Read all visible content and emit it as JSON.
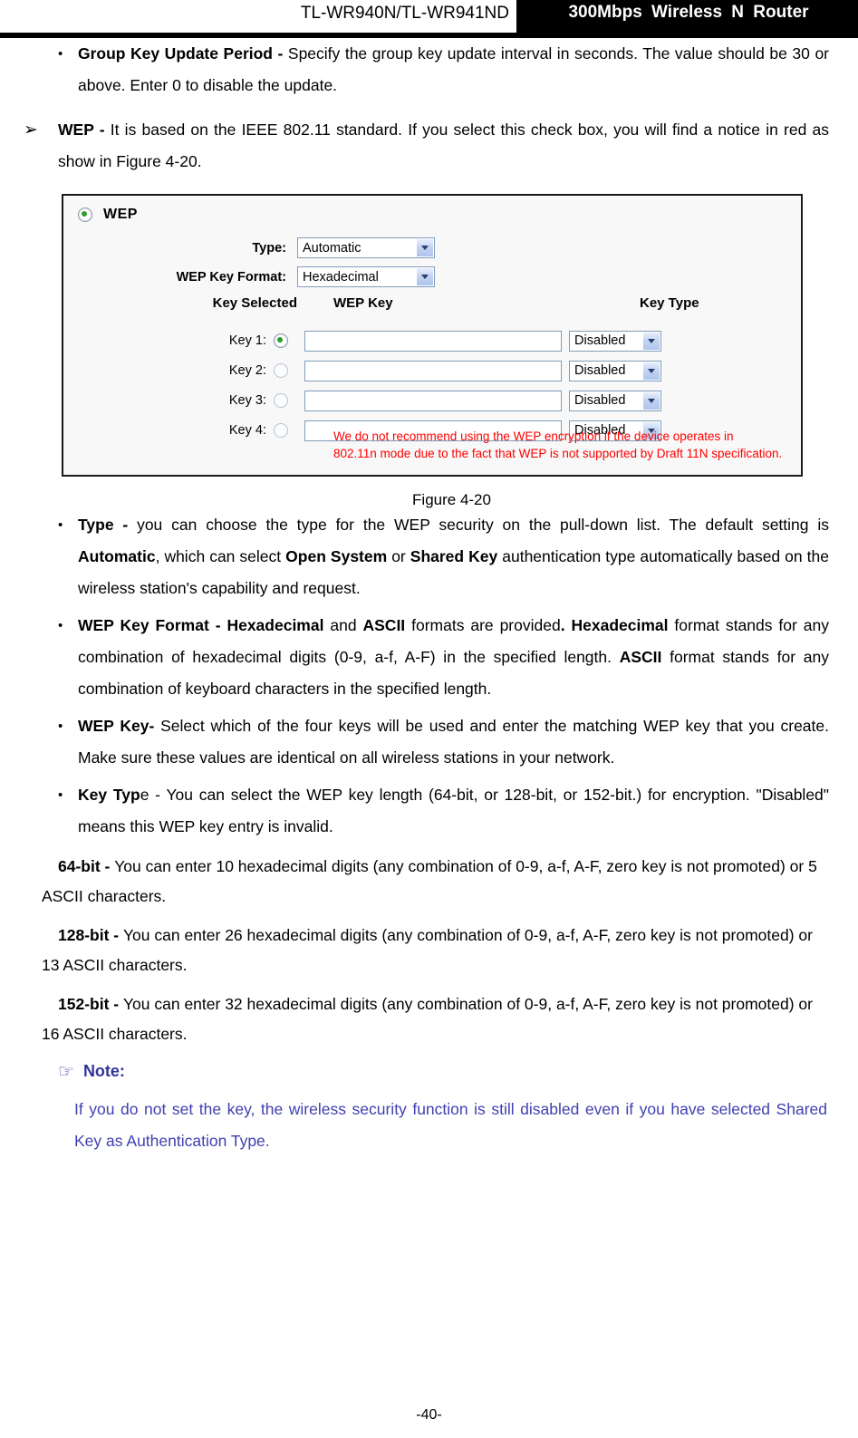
{
  "header": {
    "model": "TL-WR940N/TL-WR941ND",
    "product": "300Mbps Wireless N Router"
  },
  "body": {
    "group_key": {
      "marker": "•",
      "term": "Group Key Update Period - ",
      "text": "Specify the group key update interval in seconds. The value should be 30 or above. Enter 0 to disable the update."
    },
    "wep": {
      "marker": "➢",
      "term": "WEP - ",
      "text": "It is based on the IEEE 802.11 standard. If you select this check box, you will find a notice in red as show in Figure 4-20."
    },
    "type_item": {
      "marker": "•",
      "term": "Type - ",
      "t1": "you can choose the type for the WEP security on the pull-down list. The default setting is ",
      "b1": "Automatic",
      "t2": ", which can select  ",
      "b2": "Open System",
      "t3": " or ",
      "b3": "Shared Key",
      "t4": " authentication type automatically based on the wireless station's capability and request."
    },
    "format_item": {
      "marker": "•",
      "b0": "WEP Key Format - ",
      "b1": "Hexadecimal",
      "t1": " and ",
      "b2": "ASCII",
      "t2": " formats are provided",
      "b3": ".",
      "t3": "  ",
      "b4": "Hexadecimal",
      "t4": " format stands for any combination of hexadecimal digits (0-9, a-f, A-F) in the specified length. ",
      "b5": "ASCII",
      "t5": " format stands for any combination of keyboard characters in the specified length."
    },
    "wepkey_item": {
      "marker": "•",
      "term": "WEP Key- ",
      "text": "Select which of the four keys will be used and enter the matching WEP key that you create. Make sure these values are identical on all wireless stations in your network."
    },
    "keytype_item": {
      "marker": "•",
      "term_bold": "Key Typ",
      "term_rest": "e - ",
      "text": "You can select the WEP key length (64-bit, or 128-bit, or 152-bit.) for encryption. \"Disabled\" means this WEP key entry is invalid."
    },
    "bit64": {
      "lead": "64-bit - ",
      "text": " You can enter 10 hexadecimal digits (any combination of 0-9, a-f, A-F, zero key is not promoted) or 5 ASCII characters."
    },
    "bit128": {
      "lead": "128-bit - ",
      "text": "You can enter 26 hexadecimal digits (any combination of 0-9, a-f, A-F, zero key is not promoted) or 13 ASCII characters."
    },
    "bit152": {
      "lead": "152-bit - ",
      "text": "You can enter 32 hexadecimal digits (any combination of 0-9, a-f, A-F, zero key is not promoted) or 16 ASCII characters."
    }
  },
  "figure": {
    "caption": "Figure 4-20",
    "panel": {
      "section_title": "WEP",
      "section_radio_selected": true,
      "type_label": "Type:",
      "type_value": "Automatic",
      "format_label": "WEP Key Format:",
      "format_value": "Hexadecimal",
      "col_key_selected": "Key Selected",
      "col_wep_key": "WEP Key",
      "col_key_type": "Key Type",
      "keys": [
        {
          "label": "Key 1:",
          "selected": true,
          "value": "",
          "key_type": "Disabled"
        },
        {
          "label": "Key 2:",
          "selected": false,
          "value": "",
          "key_type": "Disabled"
        },
        {
          "label": "Key 3:",
          "selected": false,
          "value": "",
          "key_type": "Disabled"
        },
        {
          "label": "Key 4:",
          "selected": false,
          "value": "",
          "key_type": "Disabled"
        }
      ],
      "warning_line1": "We do not recommend using the WEP encryption if the device operates in",
      "warning_line2": "802.11n mode due to the fact that WEP is not supported by Draft 11N specification.",
      "warning_color": "#ff0000",
      "radio_dot_color": "#2a9d2a"
    }
  },
  "note": {
    "hand_icon": "☞",
    "label": "Note:",
    "text": "If you do not set the key, the wireless security function is still disabled even if you have selected Shared Key as Authentication Type.",
    "color": "#4040b0"
  },
  "footer": {
    "page_number": "-40-"
  }
}
